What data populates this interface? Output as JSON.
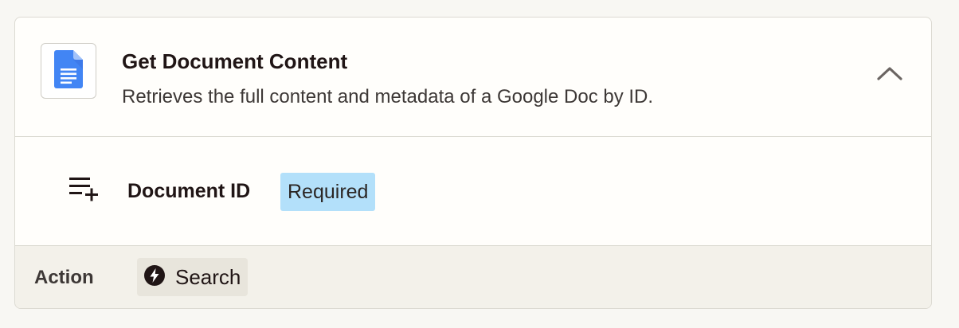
{
  "step": {
    "title": "Get Document Content",
    "description": "Retrieves the full content and metadata of a Google Doc by ID.",
    "app_icon": "google-docs-icon",
    "collapse_icon": "chevron-up-icon"
  },
  "field": {
    "icon": "playlist-add-icon",
    "label": "Document ID",
    "badge": "Required",
    "badge_color": "#b3e0fa"
  },
  "footer": {
    "label": "Action",
    "chip_icon": "lightning-bolt-icon",
    "chip_label": "Search"
  },
  "colors": {
    "google_docs_blue": "#4285f4",
    "footer_bg": "#f3f1ea"
  }
}
